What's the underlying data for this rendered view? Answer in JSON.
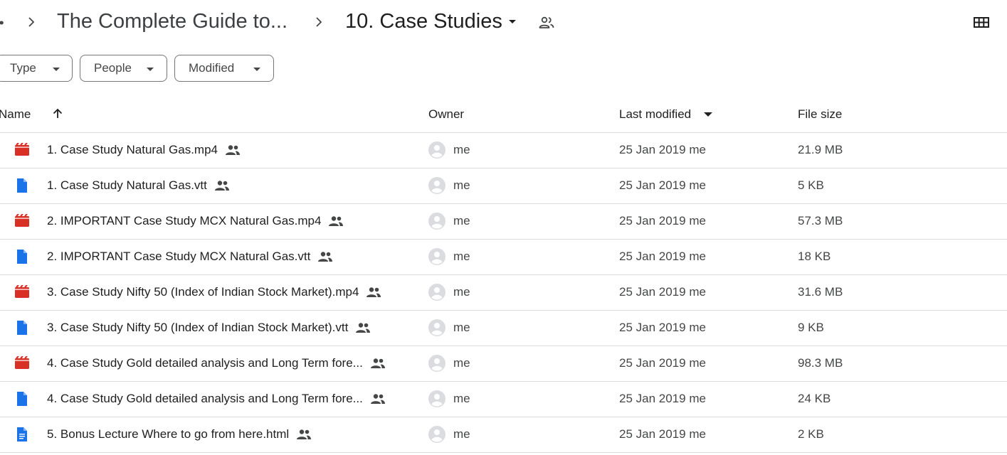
{
  "breadcrumb": {
    "more": "••",
    "parent": "The Complete Guide to...",
    "current": "10. Case Studies"
  },
  "filters": [
    {
      "label": "Type"
    },
    {
      "label": "People"
    },
    {
      "label": "Modified"
    }
  ],
  "columns": {
    "name": "Name",
    "owner": "Owner",
    "modified": "Last modified",
    "size": "File size"
  },
  "files": [
    {
      "name": "1. Case Study  Natural Gas.mp4",
      "type": "video",
      "owner": "me",
      "modified": "25 Jan 2019",
      "modified_by": "me",
      "size": "21.9 MB"
    },
    {
      "name": "1. Case Study  Natural Gas.vtt",
      "type": "file",
      "owner": "me",
      "modified": "25 Jan 2019",
      "modified_by": "me",
      "size": "5 KB"
    },
    {
      "name": "2. IMPORTANT Case Study  MCX Natural Gas.mp4",
      "type": "video",
      "owner": "me",
      "modified": "25 Jan 2019",
      "modified_by": "me",
      "size": "57.3 MB"
    },
    {
      "name": "2. IMPORTANT Case Study  MCX Natural Gas.vtt",
      "type": "file",
      "owner": "me",
      "modified": "25 Jan 2019",
      "modified_by": "me",
      "size": "18 KB"
    },
    {
      "name": "3. Case Study  Nifty 50 (Index of Indian Stock Market).mp4",
      "type": "video",
      "owner": "me",
      "modified": "25 Jan 2019",
      "modified_by": "me",
      "size": "31.6 MB"
    },
    {
      "name": "3. Case Study  Nifty 50 (Index of Indian Stock Market).vtt",
      "type": "file",
      "owner": "me",
      "modified": "25 Jan 2019",
      "modified_by": "me",
      "size": "9 KB"
    },
    {
      "name": "4. Case Study  Gold detailed analysis and Long Term fore...",
      "type": "video",
      "owner": "me",
      "modified": "25 Jan 2019",
      "modified_by": "me",
      "size": "98.3 MB"
    },
    {
      "name": "4. Case Study  Gold detailed analysis and Long Term fore...",
      "type": "file",
      "owner": "me",
      "modified": "25 Jan 2019",
      "modified_by": "me",
      "size": "24 KB"
    },
    {
      "name": "5. Bonus Lecture  Where to go from here.html",
      "type": "document",
      "owner": "me",
      "modified": "25 Jan 2019",
      "modified_by": "me",
      "size": "2 KB"
    }
  ],
  "icons": {
    "video": "video-file-icon",
    "file": "generic-file-icon",
    "document": "document-file-icon",
    "shared": "shared-people-icon",
    "grid": "grid-view-icon",
    "avatar": "default-avatar-icon"
  },
  "colors": {
    "video": "#d93025",
    "file": "#1a73e8",
    "text": "#1f1f1f",
    "muted": "#444746",
    "divider": "#dadce0"
  }
}
